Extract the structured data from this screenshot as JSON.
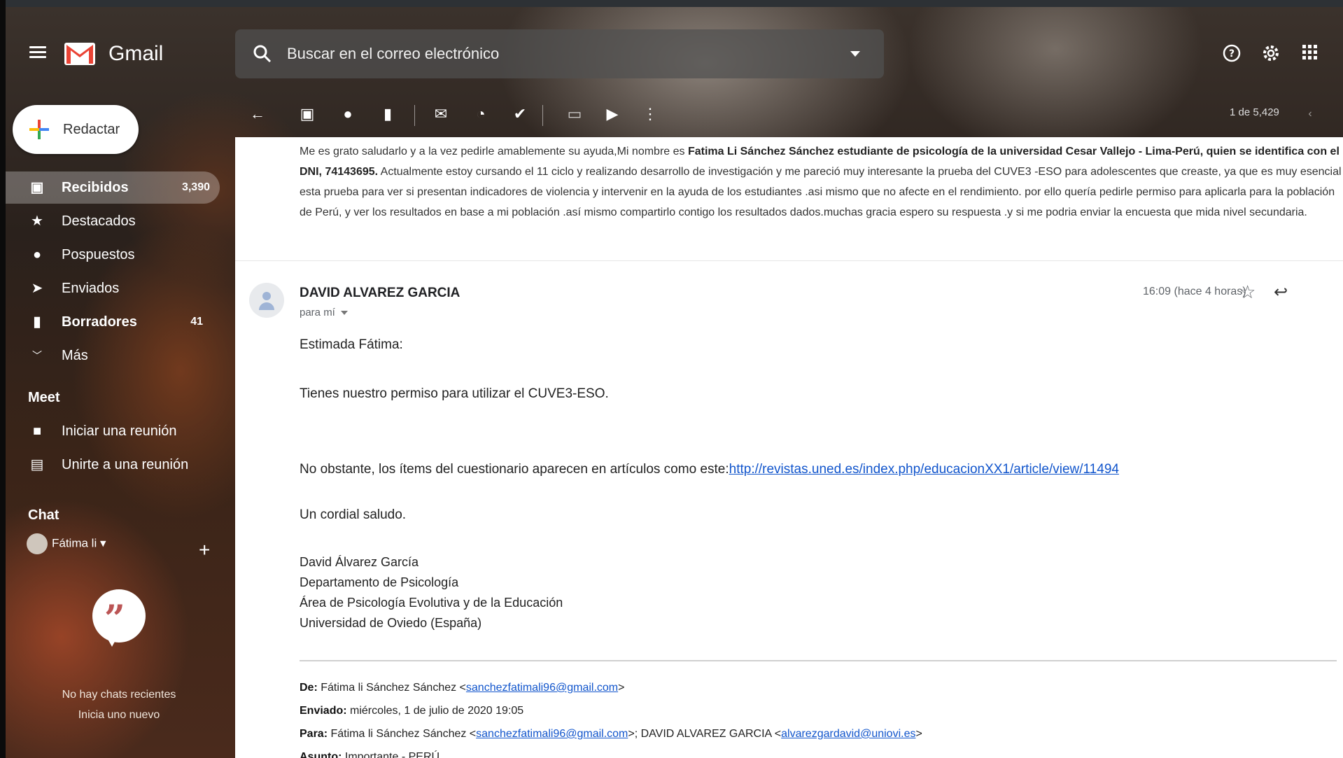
{
  "header": {
    "app_name": "Gmail",
    "search_placeholder": "Buscar en el correo electrónico"
  },
  "sidebar": {
    "compose_label": "Redactar",
    "items": [
      {
        "label": "Recibidos",
        "count": "3,390"
      },
      {
        "label": "Destacados",
        "count": ""
      },
      {
        "label": "Pospuestos",
        "count": ""
      },
      {
        "label": "Enviados",
        "count": ""
      },
      {
        "label": "Borradores",
        "count": "41"
      },
      {
        "label": "Más",
        "count": ""
      }
    ],
    "meet": {
      "title": "Meet",
      "items": [
        "Iniciar una reunión",
        "Unirte a una reunión"
      ]
    },
    "chat": {
      "title": "Chat",
      "user": "Fátima li",
      "empty_line1": "No hay chats recientes",
      "empty_line2": "Inicia uno nuevo"
    }
  },
  "toolbar": {
    "pager": "1 de 5,429"
  },
  "quoted_message": {
    "part1": "Me es grato saludarlo y a la vez pedirle amablemente su ayuda,Mi nombre es ",
    "bold": "Fatima Li Sánchez Sánchez estudiante de psicología de la universidad Cesar Vallejo - Lima-Perú, quien se identifica con el DNI, 74143695.",
    "part2": " Actualmente estoy cursando el 11 ciclo  y realizando desarrollo de investigación y me pareció muy interesante la prueba del  CUVE3 -ESO  para adolescentes  que creaste, ya que es muy esencial esta prueba para ver si presentan indicadores de violencia y intervenir en la ayuda de los estudiantes .asi mismo que no afecte en el rendimiento. por ello quería pedirle permiso para aplicarla  para la población de Perú, y ver los resultados en base a mi población .así mismo compartirlo contigo los resultados dados.muchas gracia espero su respuesta .y si me podria enviar la encuesta que mida nivel secundaria."
  },
  "message": {
    "sender": "DAVID ALVAREZ GARCIA",
    "to": "para mí",
    "time": "16:09 (hace 4 horas)",
    "greeting": "Estimada Fátima:",
    "line1": "Tienes nuestro permiso para utilizar el CUVE3-ESO.",
    "line2_prefix": "No obstante, los ítems del cuestionario aparecen en artículos como este:",
    "line2_link": "http://revistas.uned.es/index.php/educacionXX1/article/view/11494",
    "closing": "Un cordial saludo.",
    "signature": [
      "David Álvarez García",
      "Departamento de Psicología",
      "Área de Psicología Evolutiva y de la Educación",
      "Universidad de Oviedo (España)"
    ]
  },
  "forwarded": {
    "from_label": "De:",
    "from_name": "Fátima li Sánchez Sánchez <",
    "from_email": "sanchezfatimali96@gmail.com",
    "from_end": ">",
    "sent_label": "Enviado:",
    "sent_value": "miércoles, 1 de julio de 2020 19:05",
    "to_label": "Para:",
    "to_name1": "Fátima li Sánchez Sánchez <",
    "to_email1": "sanchezfatimali96@gmail.com",
    "to_mid": ">; DAVID ALVAREZ GARCIA <",
    "to_email2": "alvarezgardavid@uniovi.es",
    "to_end": ">",
    "subject_label": "Asunto:",
    "subject_value": "Importante - PERÚ"
  },
  "icons": [
    "menu-icon",
    "search-icon",
    "help-icon",
    "settings-icon",
    "apps-icon",
    "back-icon",
    "archive-icon",
    "report-spam-icon",
    "delete-icon",
    "mark-unread-icon",
    "snooze-icon",
    "add-task-icon",
    "move-to-icon",
    "label-icon",
    "more-icon",
    "star-icon",
    "reply-icon"
  ],
  "colors": {
    "gmail_red": "#ea4335",
    "link": "#1155cc"
  }
}
